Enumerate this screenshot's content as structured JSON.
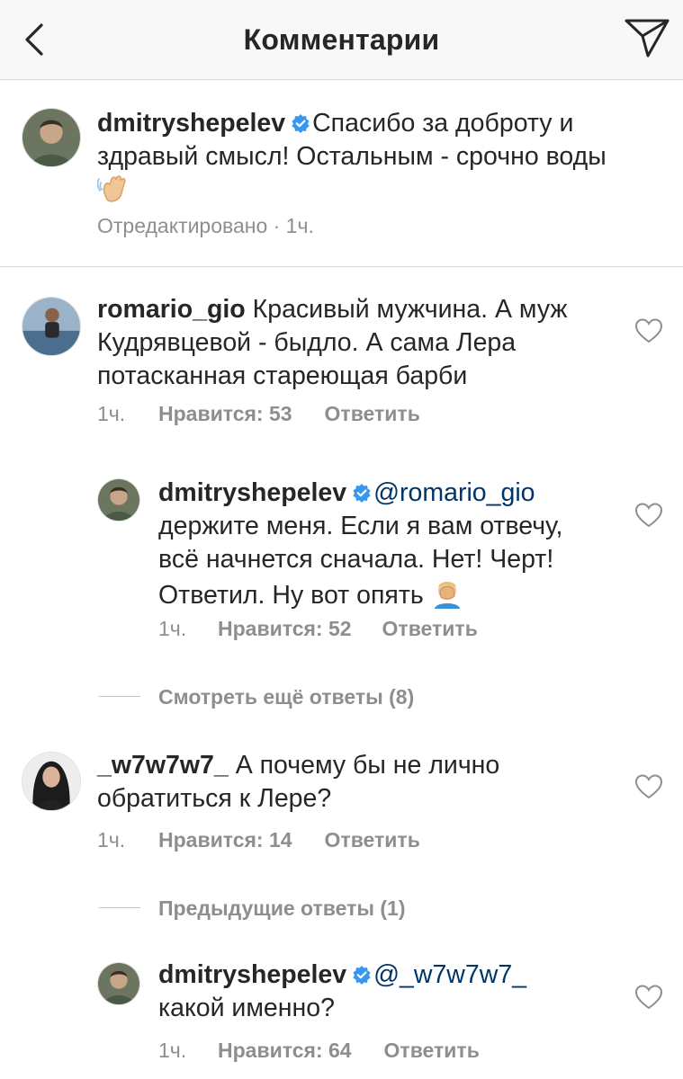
{
  "header": {
    "title": "Комментарии"
  },
  "caption": {
    "username": "dmitryshepelev",
    "text": "Спасибо за доброту и",
    "text_line2": "здравый смысл! Остальным - срочно воды",
    "emoji": "waving-hand",
    "edited": "Отредактировано · 1ч."
  },
  "comments": [
    {
      "username": "romario_gio",
      "line1": "Красивый мужчина. А муж",
      "line2": "Кудрявцевой - быдло. А сама Лера",
      "line3": "потасканная стареющая барби",
      "time": "1ч.",
      "likes": "Нравится: 53",
      "reply": "Ответить",
      "replies": [
        {
          "username": "dmitryshepelev",
          "mention": "@romario_gio",
          "line2": "держите меня. Если я вам отвечу,",
          "line3": "всё начнется сначала. Нет! Черт!",
          "line4": "Ответил. Ну вот опять",
          "emoji": "facepalm",
          "time": "1ч.",
          "likes": "Нравится: 52",
          "reply": "Ответить"
        }
      ],
      "view_more": "Смотреть ещё ответы (8)"
    },
    {
      "username": "_w7w7w7_",
      "line1": "А почему бы не лично",
      "line2": "обратиться к Лере?",
      "time": "1ч.",
      "likes": "Нравится: 14",
      "reply": "Ответить",
      "previous_replies": "Предыдущие ответы (1)",
      "replies": [
        {
          "username": "dmitryshepelev",
          "mention": "@_w7w7w7_",
          "line2": "какой именно?",
          "time": "1ч.",
          "likes": "Нравится: 64",
          "reply": "Ответить"
        }
      ]
    }
  ],
  "colors": {
    "text": "#262626",
    "secondary": "#8e8e8e",
    "mention": "#003569",
    "verified": "#3897f0",
    "divider": "#dbdbdb"
  }
}
